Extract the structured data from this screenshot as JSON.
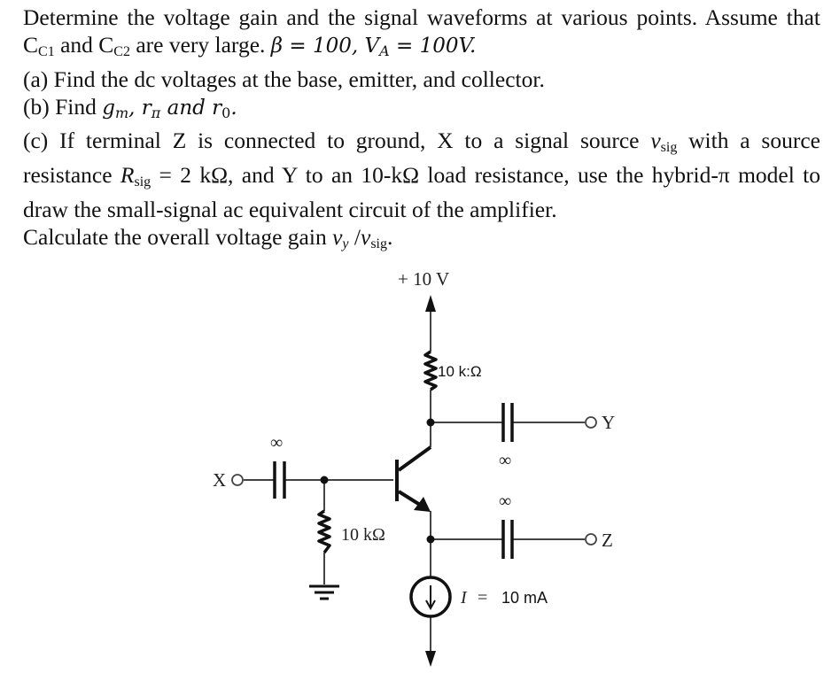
{
  "problem": {
    "line1": "Determine the voltage gain and the signal waveforms at various points. Assume that",
    "line2_cap1": "C",
    "line2_cap1_sub": "C1",
    "line2_and": " and ",
    "line2_cap2": "C",
    "line2_cap2_sub": "C2",
    "line2_rest": " are very large. ",
    "line2_beta": "β = 100, V",
    "line2_va_sub": "A",
    "line2_va": " = 100V.",
    "part_a": "(a) Find the dc voltages at the base, emitter, and collector.",
    "part_b_prefix": "(b) Find ",
    "part_b_gm": "g",
    "part_b_gm_sub": "m",
    "part_b_rpi": ", r",
    "part_b_rpi_sub": "π",
    "part_b_and": " and r",
    "part_b_ro_sub": "0",
    "part_b_end": ".",
    "part_c_line1_a": "(c) If terminal Z is connected to ground, X to a signal source ",
    "part_c_vsig": "v",
    "part_c_vsig_sub": "sig",
    "part_c_line1_b": " with a source",
    "part_c_line2_a": "resistance ",
    "part_c_rsig": "R",
    "part_c_rsig_sub": "sig",
    "part_c_line2_b": " = 2 kΩ, and Y to an 10-kΩ load resistance, use the hybrid-π model to",
    "part_c_line3": "draw the small-signal ac equivalent circuit of the amplifier.",
    "calc_prefix": "Calculate the overall voltage gain ",
    "calc_vy": "v",
    "calc_vy_sub": "y",
    "calc_slash": " /",
    "calc_vsig": "v",
    "calc_vsig_sub": "sig",
    "calc_end": "."
  },
  "circuit": {
    "supply_label": "+ 10 V",
    "rc_label": "10 k:Ω",
    "rb_label": "10 kΩ",
    "cap_in_label": "∞",
    "cap_out_c_label": "∞",
    "cap_out_e_label": "∞",
    "terminal_x": "X",
    "terminal_y": "Y",
    "terminal_z": "Z",
    "current_label_i": "I",
    "current_label_eq": "=",
    "current_value": "10 mA"
  }
}
